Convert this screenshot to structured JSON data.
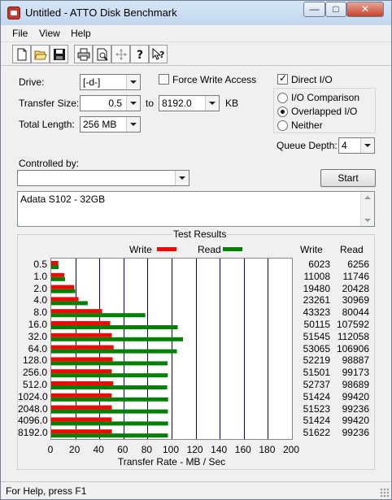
{
  "window": {
    "title": "Untitled - ATTO Disk Benchmark",
    "min_glyph": "—",
    "max_glyph": "□",
    "close_glyph": "✕"
  },
  "menu": {
    "items": [
      "File",
      "View",
      "Help"
    ]
  },
  "toolbar": {
    "icons": [
      "new-icon",
      "open-icon",
      "save-icon",
      "print-icon",
      "print-preview-icon",
      "move-icon",
      "help-icon",
      "context-help-icon"
    ]
  },
  "form": {
    "drive_label": "Drive:",
    "drive_value": "[-d-]",
    "force_write_label": "Force Write Access",
    "force_write_checked": false,
    "direct_io_label": "Direct I/O",
    "direct_io_checked": true,
    "transfer_size_label": "Transfer Size:",
    "transfer_from": "0.5",
    "to_label": "to",
    "transfer_to": "8192.0",
    "kb_label": "KB",
    "total_length_label": "Total Length:",
    "total_length_value": "256 MB",
    "io_options": [
      {
        "label": "I/O Comparison",
        "checked": false
      },
      {
        "label": "Overlapped I/O",
        "checked": true
      },
      {
        "label": "Neither",
        "checked": false
      }
    ],
    "queue_depth_label": "Queue Depth:",
    "queue_depth_value": "4",
    "controlled_by_label": "Controlled by:",
    "controlled_by_value": "",
    "start_label": "Start",
    "description": "Adata S102 - 32GB"
  },
  "results": {
    "title": "Test Results",
    "write_legend": "Write",
    "read_legend": "Read",
    "write_col": "Write",
    "read_col": "Read",
    "xlabel": "Transfer Rate - MB / Sec"
  },
  "chart_data": {
    "type": "bar",
    "orientation": "horizontal",
    "categories": [
      "0.5",
      "1.0",
      "2.0",
      "4.0",
      "8.0",
      "16.0",
      "32.0",
      "64.0",
      "128.0",
      "256.0",
      "512.0",
      "1024.0",
      "2048.0",
      "4096.0",
      "8192.0"
    ],
    "series": [
      {
        "name": "Write",
        "color": "#ff0000",
        "values": [
          6023,
          11008,
          19480,
          23261,
          43323,
          50115,
          51545,
          53065,
          52219,
          51501,
          52737,
          51424,
          51523,
          51424,
          51622
        ]
      },
      {
        "name": "Read",
        "color": "#008000",
        "values": [
          6256,
          11746,
          20428,
          30969,
          80044,
          107592,
          112058,
          106906,
          98887,
          99173,
          98689,
          99420,
          99236,
          99420,
          99236
        ]
      }
    ],
    "xlabel": "Transfer Rate - MB / Sec",
    "xlim": [
      0,
      200
    ],
    "xticks": [
      0,
      20,
      40,
      60,
      80,
      100,
      120,
      140,
      160,
      180,
      200
    ],
    "grid": true,
    "grid_color": "#00008b",
    "legend": "top"
  },
  "status": {
    "text": "For Help, press F1"
  }
}
